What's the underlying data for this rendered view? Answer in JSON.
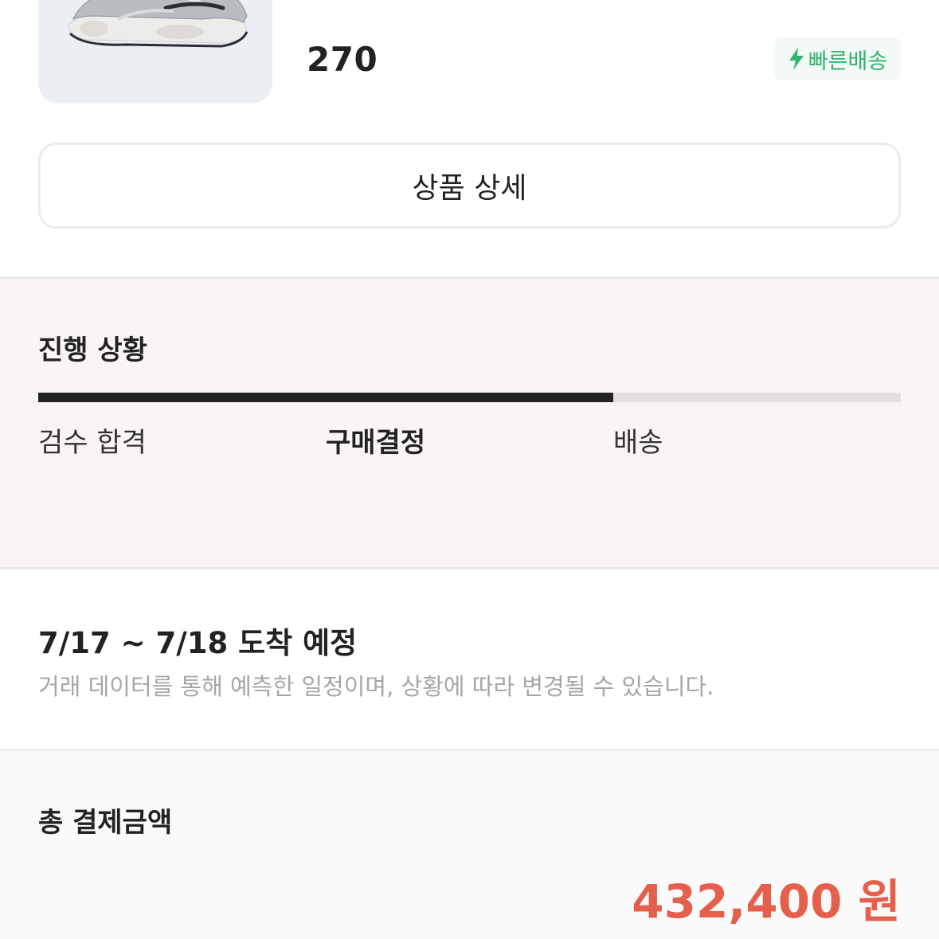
{
  "product": {
    "size": "270",
    "image_alt": "grey-silver-running-sneaker",
    "badge": {
      "label": "빠른배송",
      "icon": "lightning-bolt-icon",
      "color": "#31b46e"
    },
    "detail_button_label": "상품 상세"
  },
  "progress": {
    "title": "진행 상황",
    "fill_fraction": 0.667,
    "steps": [
      {
        "label": "검수 합격",
        "active": false
      },
      {
        "label": "구매결정",
        "active": true
      },
      {
        "label": "배송",
        "active": false
      }
    ]
  },
  "arrival": {
    "title": "7/17 ~ 7/18 도착 예정",
    "note": "거래 데이터를 통해 예측한 일정이며, 상황에 따라 변경될 수 있습니다."
  },
  "payment": {
    "title": "총 결제금액",
    "amount": "432,400 원",
    "amount_color": "#e5604c"
  }
}
